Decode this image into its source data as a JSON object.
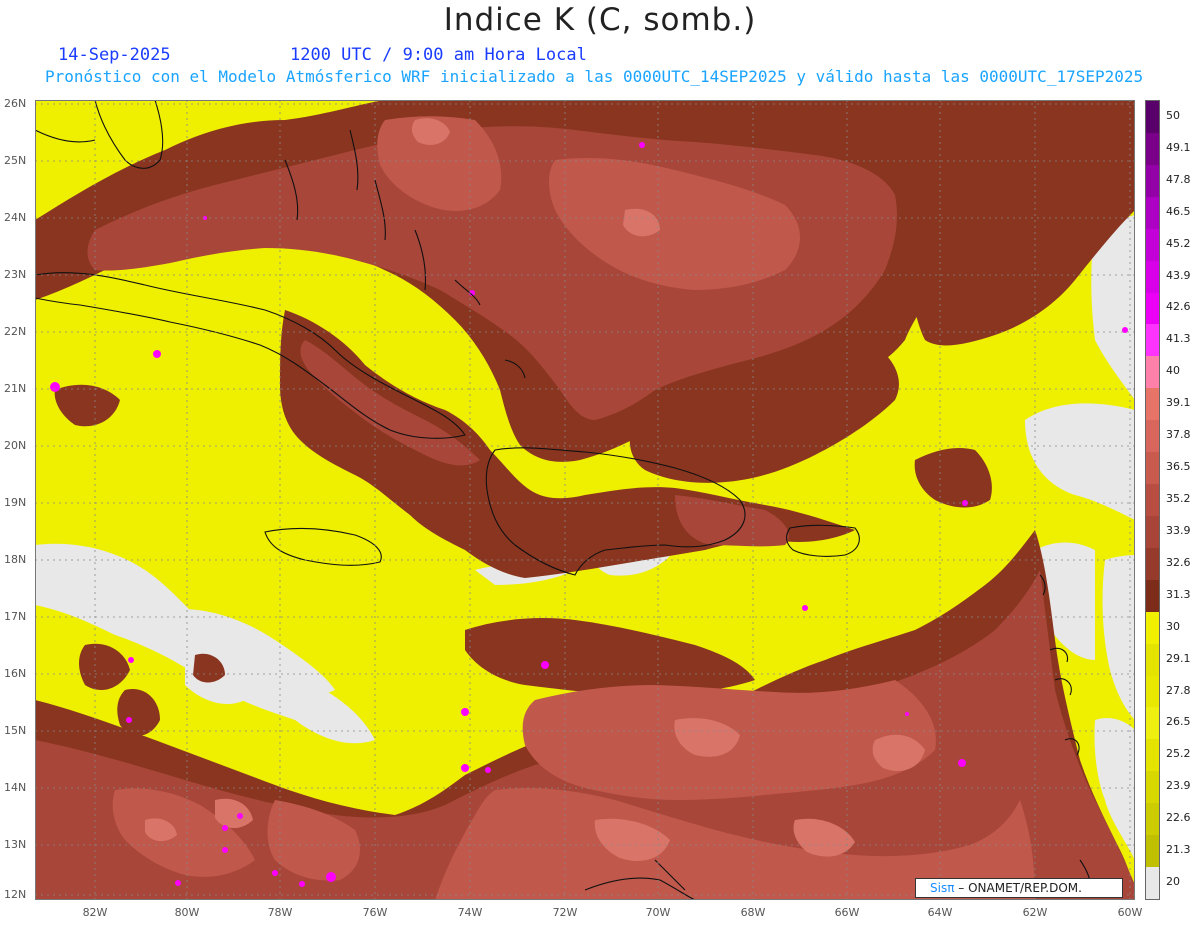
{
  "header": {
    "title": "Indice K (C, somb.)",
    "date": "14-Sep-2025",
    "time": "1200 UTC / 9:00 am Hora Local",
    "subtitle": "Pronóstico con el Modelo Atmósferico WRF inicializado a las 0000UTC_14SEP2025 y válido hasta las  0000UTC_17SEP2025"
  },
  "map": {
    "lat_labels": [
      "26N",
      "25N",
      "24N",
      "23N",
      "22N",
      "21N",
      "20N",
      "19N",
      "18N",
      "17N",
      "16N",
      "15N",
      "14N",
      "13N",
      "12N"
    ],
    "lon_labels": [
      "82W",
      "80W",
      "78W",
      "76W",
      "74W",
      "72W",
      "70W",
      "68W",
      "66W",
      "64W",
      "62W",
      "60W"
    ],
    "lat_range": [
      12,
      26
    ],
    "lon_range": [
      -83,
      -60
    ],
    "grid": "dotted",
    "colors": {
      "below_20": "#e8e8e8",
      "yellow_band": "#f2f200",
      "brown_dark": "#8a3520",
      "brown_mid": "#a8463a",
      "brown_light": "#c0584c",
      "salmon": "#d87468",
      "magenta": "#ff00ff"
    }
  },
  "legend": {
    "labels": [
      "50",
      "49.1",
      "47.8",
      "46.5",
      "45.2",
      "43.9",
      "42.6",
      "41.3",
      "40",
      "39.1",
      "37.8",
      "36.5",
      "35.2",
      "33.9",
      "32.6",
      "31.3",
      "30",
      "29.1",
      "27.8",
      "26.5",
      "25.2",
      "23.9",
      "22.6",
      "21.3",
      "20"
    ],
    "colors": [
      "#5a006a",
      "#7a008a",
      "#9400a8",
      "#ae00c4",
      "#c400d8",
      "#d800e8",
      "#ec00f6",
      "#ff33ff",
      "#ff80a8",
      "#e87468",
      "#d8665c",
      "#c85a4e",
      "#b84e42",
      "#a84438",
      "#963a2c",
      "#7c2c18",
      "#f0f000",
      "#e4e400",
      "#e8e800",
      "#f0f010",
      "#e4e400",
      "#d8d800",
      "#cccc00",
      "#c0c000",
      "#e8e8e8"
    ]
  },
  "credit": {
    "brand": "Sisπ",
    "text": "– ONAMET/REP.DOM."
  }
}
